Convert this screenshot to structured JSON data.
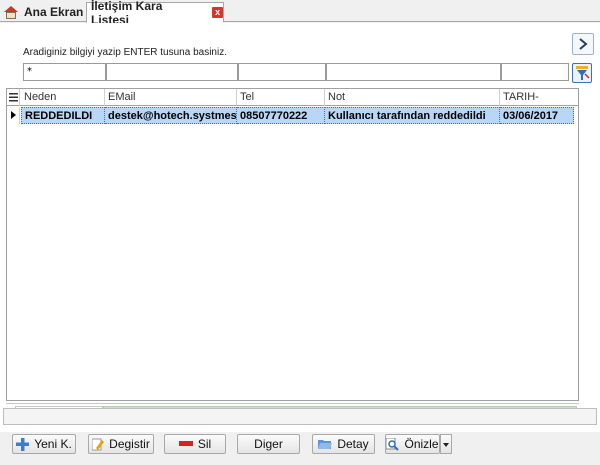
{
  "tabs": {
    "home_label": "Ana Ekran",
    "active_label": "İletişim Kara Listesi",
    "close_glyph": "x"
  },
  "search": {
    "hint": "Aradiginiz bilgiyi yazip ENTER tusuna basiniz.",
    "filters": [
      "*",
      "",
      "",
      "",
      ""
    ]
  },
  "grid": {
    "columns": [
      "Neden",
      "EMail",
      "Tel",
      "Not",
      "TARIH-"
    ],
    "rows": [
      [
        "REDDEDILDI",
        "destek@hotech.systmes",
        "08507770222",
        "Kullanıcı tarafından reddedildi",
        "03/06/2017"
      ]
    ],
    "selected_row": 0,
    "record_count": "1"
  },
  "buttons": {
    "new": "Yeni K.",
    "edit": "Degistir",
    "delete": "Sil",
    "other": "Diger",
    "detail": "Detay",
    "preview": "Önizle"
  },
  "colors": {
    "selection": "#b8d6f5",
    "footer_bar": "#c9e2c6",
    "close_icon": "#d9342b"
  }
}
